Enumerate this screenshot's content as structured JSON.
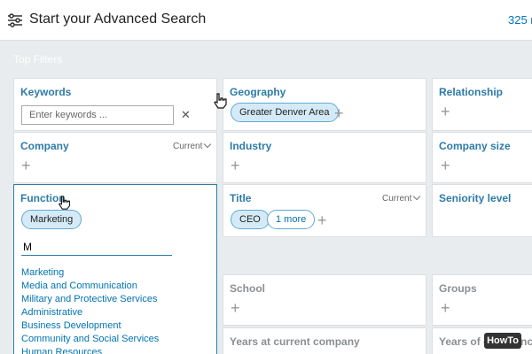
{
  "header": {
    "title": "Start your Advanced Search",
    "results_count": "325 r",
    "icon": "filter-sliders-icon"
  },
  "section_label": "Top Filters",
  "keywords": {
    "label": "Keywords",
    "placeholder": "Enter keywords ...",
    "clear": "✕"
  },
  "geography": {
    "label": "Geography",
    "tags": [
      "Greater Denver Area"
    ]
  },
  "relationship": {
    "label": "Relationship"
  },
  "company": {
    "label": "Company",
    "scope": "Current"
  },
  "industry": {
    "label": "Industry"
  },
  "company_size": {
    "label": "Company size"
  },
  "function": {
    "label": "Function",
    "tags": [
      "Marketing"
    ],
    "typed_value": "M",
    "suggestions": [
      "Marketing",
      "Media and Communication",
      "Military and Protective Services",
      "Administrative",
      "Business Development",
      "Community and Social Services",
      "Human Resources"
    ]
  },
  "title": {
    "label": "Title",
    "scope": "Current",
    "tags": [
      "CEO"
    ],
    "more": "1 more"
  },
  "seniority": {
    "label": "Seniority level"
  },
  "school": {
    "label": "School"
  },
  "groups": {
    "label": "Groups"
  },
  "years_current": {
    "label": "Years at current company"
  },
  "years_experience": {
    "label": "Years of experience"
  },
  "plus_glyph": "+",
  "watermark": "HowTo"
}
